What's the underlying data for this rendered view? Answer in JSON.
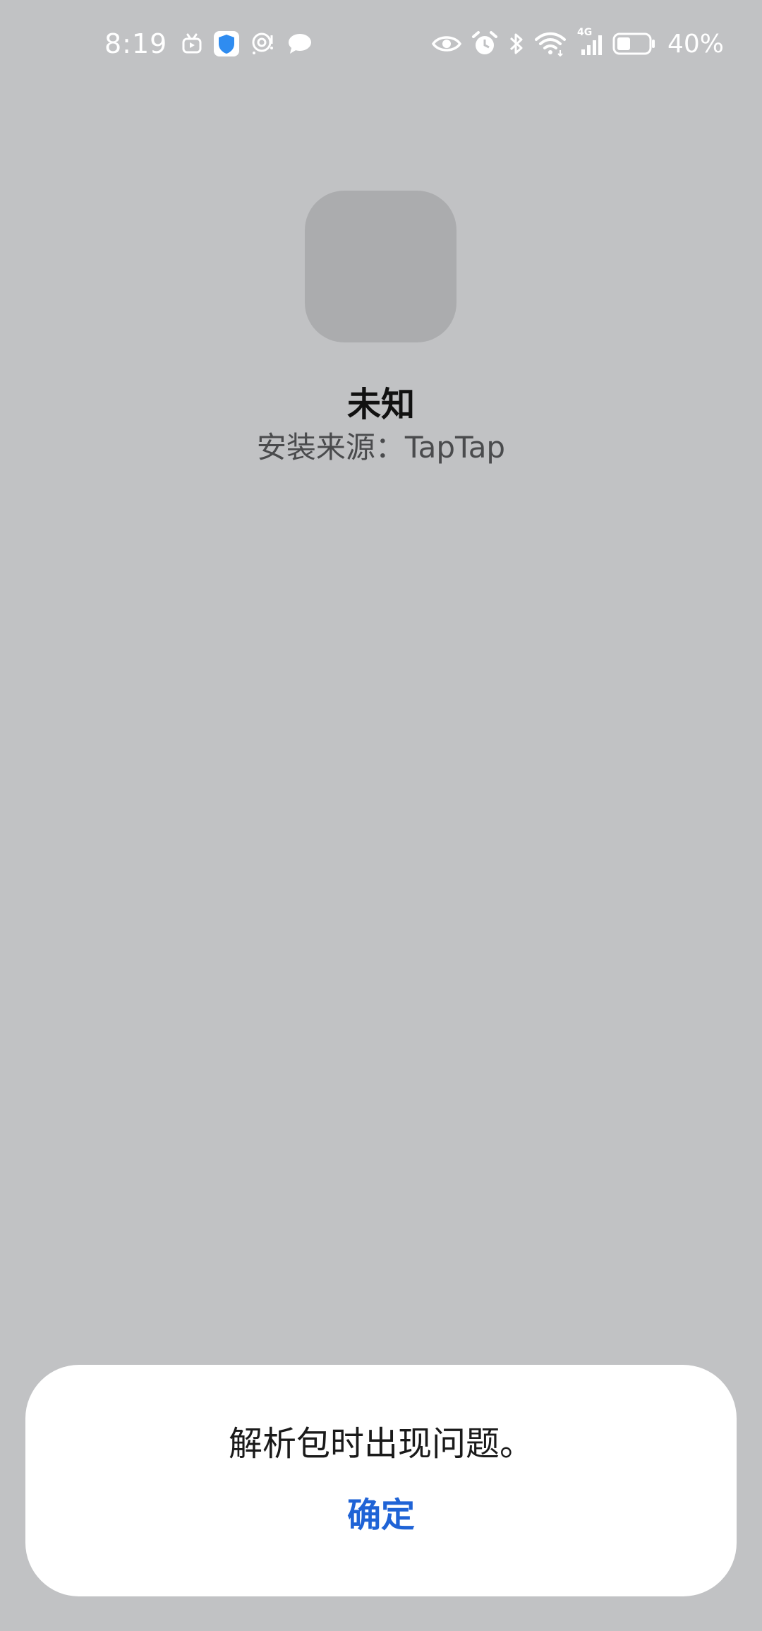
{
  "status_bar": {
    "time": "8:19",
    "battery": "40%",
    "network_type": "4G",
    "left_icons": [
      "tv-icon",
      "shield-icon",
      "target-icon",
      "chat-bubble-icon"
    ],
    "right_icons": [
      "eye-icon",
      "alarm-icon",
      "bluetooth-icon",
      "wifi-icon",
      "signal-icon",
      "battery-icon"
    ]
  },
  "app": {
    "name": "未知",
    "source": "安装来源：TapTap"
  },
  "dialog": {
    "message": "解析包时出现问题。",
    "confirm_label": "确定"
  },
  "colors": {
    "background": "#c1c2c4",
    "icon_placeholder": "#abacae",
    "dialog_bg": "#ffffff",
    "accent": "#1f63d6",
    "shield_blue": "#2f8cf0"
  }
}
